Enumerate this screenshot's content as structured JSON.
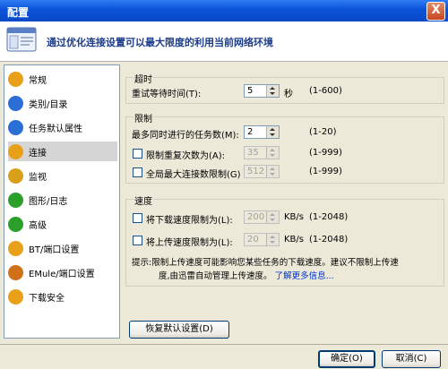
{
  "window": {
    "title": "配置",
    "close_label": "X"
  },
  "header": {
    "text": "通过优化连接设置可以最大限度的利用当前网络环境"
  },
  "sidebar": {
    "items": [
      {
        "label": "常规",
        "color": "#e8a018"
      },
      {
        "label": "类别/目录",
        "color": "#2b6fd6"
      },
      {
        "label": "任务默认属性",
        "color": "#2b6fd6"
      },
      {
        "label": "连接",
        "color": "#e8a018"
      },
      {
        "label": "监视",
        "color": "#d8a018"
      },
      {
        "label": "图形/日志",
        "color": "#2aa02a"
      },
      {
        "label": "高级",
        "color": "#2aa02a"
      },
      {
        "label": "BT/端口设置",
        "color": "#e8a018"
      },
      {
        "label": "EMule/端口设置",
        "color": "#d07018"
      },
      {
        "label": "下载安全",
        "color": "#e8a018"
      }
    ],
    "active_index": 3
  },
  "timeout": {
    "group_label": "超时",
    "retry_label": "重试等待时间(T):",
    "retry_value": "5",
    "retry_unit": "秒",
    "retry_range": "(1-600)"
  },
  "limits": {
    "group_label": "限制",
    "max_tasks_label": "最多同时进行的任务数(M):",
    "max_tasks_value": "2",
    "max_tasks_range": "(1-20)",
    "retry_limit_label": "限制重复次数为(A):",
    "retry_limit_value": "35",
    "retry_limit_range": "(1-999)",
    "global_conn_label": "全局最大连接数限制(G)",
    "global_conn_value": "512",
    "global_conn_range": "(1-999)"
  },
  "speed": {
    "group_label": "速度",
    "down_label": "将下载速度限制为(L):",
    "down_value": "200",
    "down_unit": "KB/s",
    "down_range": "(1-2048)",
    "up_label": "将上传速度限制为(L):",
    "up_value": "20",
    "up_unit": "KB/s",
    "up_range": "(1-2048)",
    "hint_line1": "提示:限制上传速度可能影响您某些任务的下载速度。建议不限制上传速",
    "hint_line2": "度,由迅雷自动管理上传速度。",
    "hint_link": "了解更多信息..."
  },
  "buttons": {
    "restore": "恢复默认设置(D)",
    "ok": "确定(O)",
    "cancel": "取消(C)"
  }
}
